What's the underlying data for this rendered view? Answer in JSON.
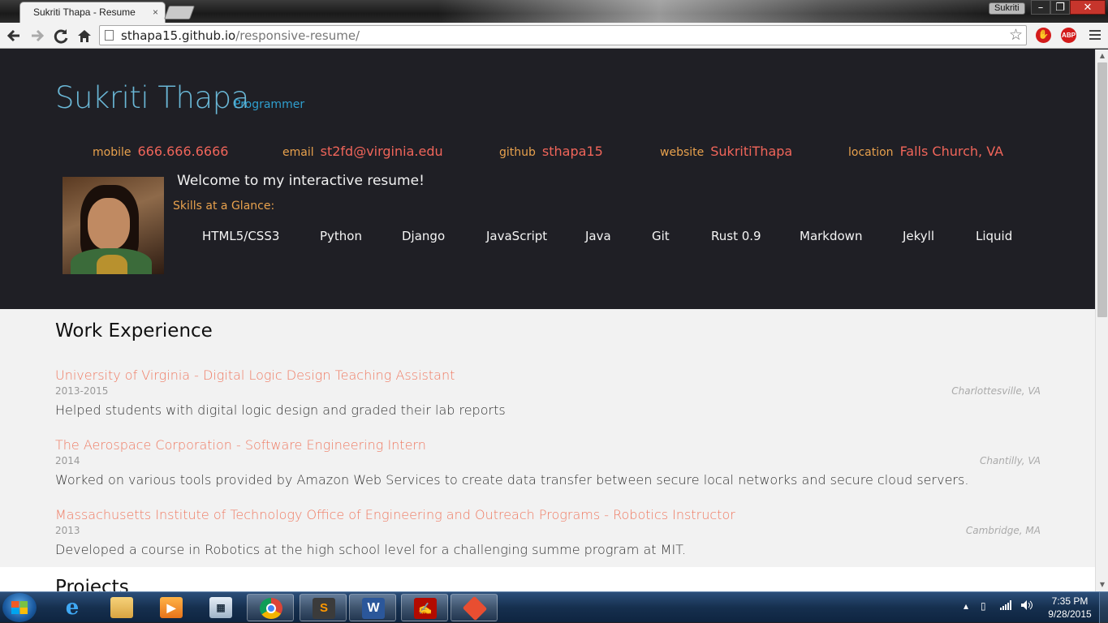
{
  "browser": {
    "tab_title": "Sukriti Thapa - Resume",
    "tab_close": "×",
    "profile_name": "Sukriti",
    "url_host": "sthapa15.github.io",
    "url_path": "/responsive-resume/",
    "icons": [
      "back-arrow-icon",
      "forward-arrow-icon",
      "reload-icon",
      "home-icon",
      "page-icon",
      "star-icon",
      "stop-extension-icon",
      "adblock-icon",
      "menu-icon"
    ],
    "ext_adblock_label": "ABP"
  },
  "header": {
    "name": "Sukriti Thapa",
    "role": "Programmer",
    "contacts": [
      {
        "label": "mobile",
        "value": "666.666.6666"
      },
      {
        "label": "email",
        "value": "st2fd@virginia.edu"
      },
      {
        "label": "github",
        "value": "sthapa15"
      },
      {
        "label": "website",
        "value": "SukritiThapa"
      },
      {
        "label": "location",
        "value": "Falls Church, VA"
      }
    ],
    "welcome": "Welcome to my interactive resume!",
    "skills_title": "Skills at a Glance:",
    "skills": [
      "HTML5/CSS3",
      "Python",
      "Django",
      "JavaScript",
      "Java",
      "Git",
      "Rust 0.9",
      "Markdown",
      "Jekyll",
      "Liquid"
    ]
  },
  "work": {
    "title": "Work Experience",
    "jobs": [
      {
        "title": "University of Virginia - Digital Logic Design Teaching Assistant",
        "dates": "2013-2015",
        "location": "Charlottesville, VA",
        "description": "Helped students with digital logic design and graded their lab reports"
      },
      {
        "title": "The Aerospace Corporation - Software Engineering Intern",
        "dates": "2014",
        "location": "Chantilly, VA",
        "description": "Worked on various tools provided by Amazon Web Services to create data transfer between secure local networks and secure cloud servers."
      },
      {
        "title": "Massachusetts Institute of Technology Office of Engineering and Outreach Programs - Robotics Instructor",
        "dates": "2013",
        "location": "Cambridge, MA",
        "description": "Developed a course in Robotics at the high school level for a challenging summe program at MIT."
      }
    ]
  },
  "projects": {
    "title": "Projects"
  },
  "taskbar": {
    "apps": [
      "internet-explorer",
      "file-explorer",
      "media-player",
      "calculator",
      "chrome",
      "sublime-text",
      "word",
      "acrobat",
      "git"
    ],
    "clock_time": "7:35 PM",
    "clock_date": "9/28/2015"
  },
  "colors": {
    "header_bg": "#1f1f25",
    "name": "#6ab7d6",
    "accent_orange": "#e8a14d",
    "accent_red": "#f0655a",
    "job_title": "#ef7a62",
    "content_bg": "#f2f2f2"
  }
}
